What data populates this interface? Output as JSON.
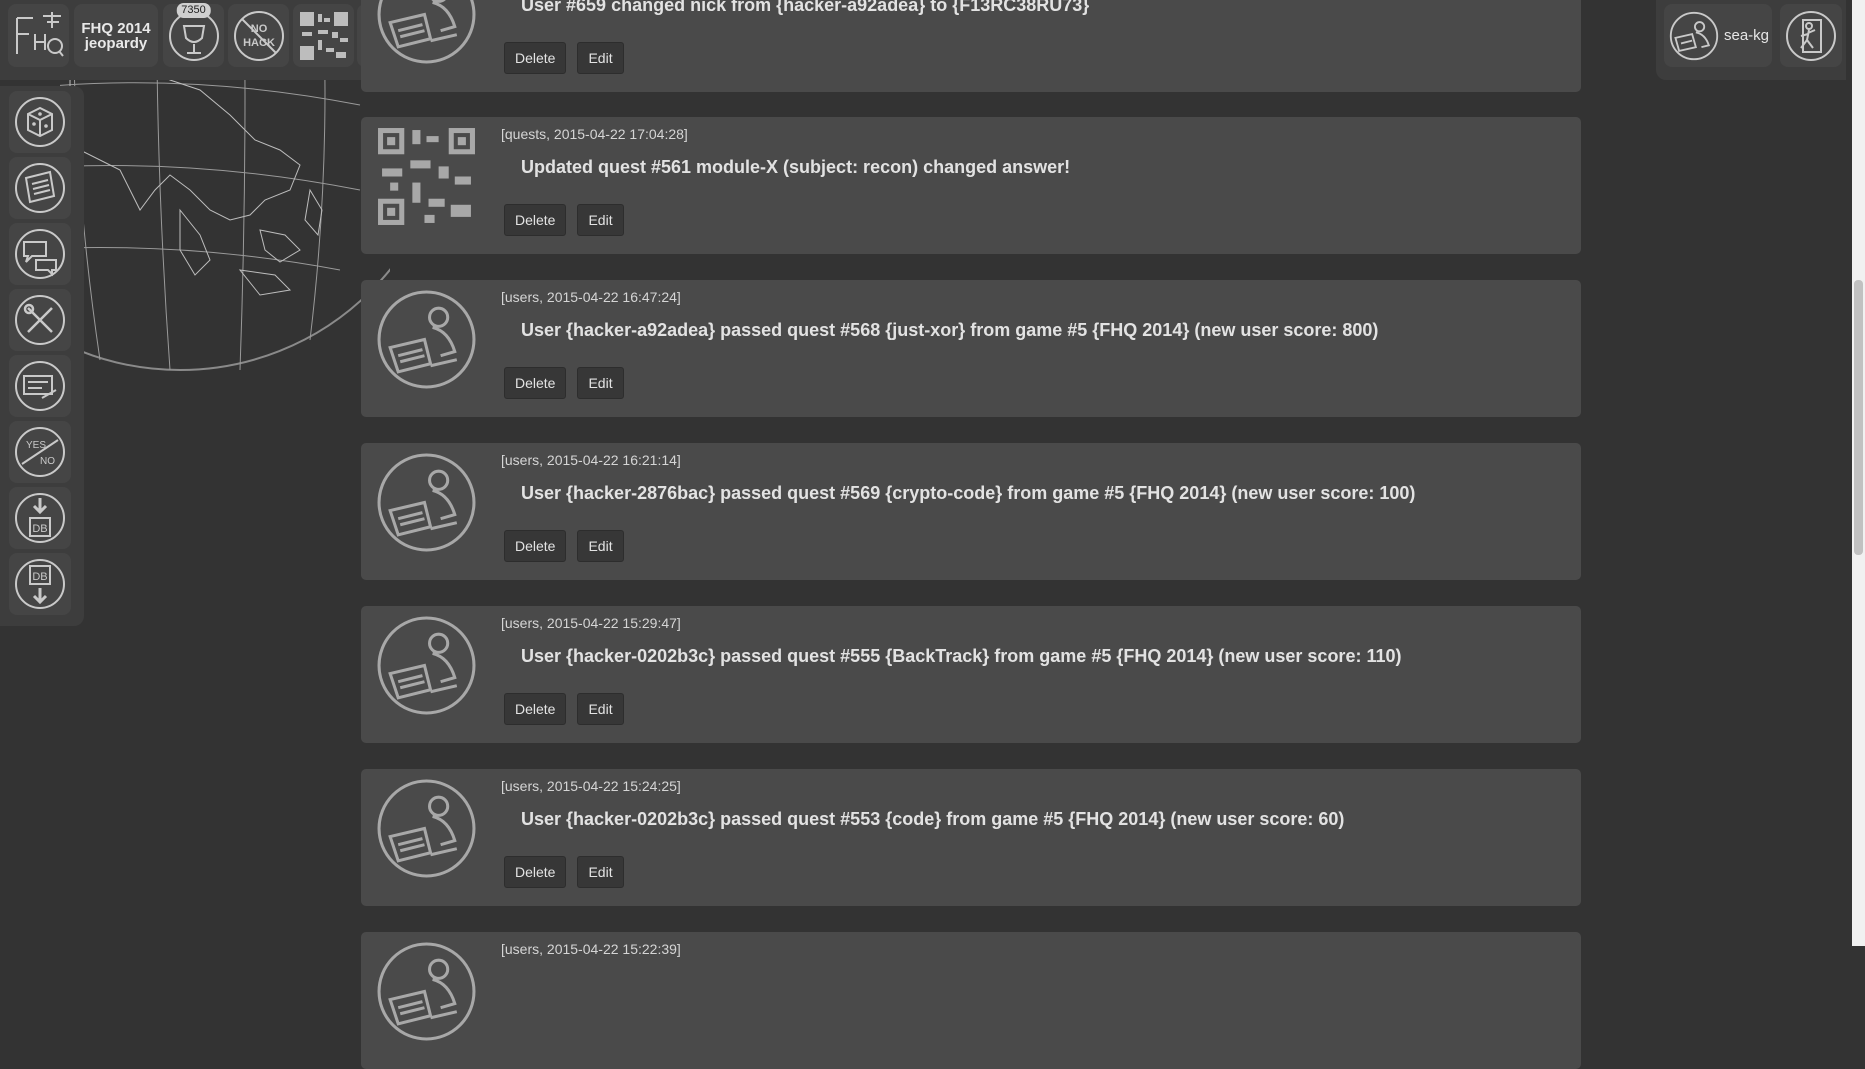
{
  "toolbar": {
    "logo_icon": "fhq-logo-icon",
    "game_title_line1": "FHQ 2014",
    "game_title_line2": "jeopardy",
    "score": "7350",
    "buttons": [
      "scoreboard-trophy-icon",
      "no-hack-icon",
      "qr-code-icon",
      "stats-pie-icon"
    ]
  },
  "sidebar": {
    "items": [
      "dice-icon",
      "news-icon",
      "chat-icon",
      "tools-icon",
      "feedback-icon",
      "yes-no-icon",
      "db-import-icon",
      "db-export-icon"
    ]
  },
  "user": {
    "name": "sea-kg",
    "avatar": "user-avatar-icon",
    "logout": "logout-icon"
  },
  "feed": {
    "items": [
      {
        "meta": "",
        "message": "User #659 changed nick from {hacker-a92adea} to {F13RC38RU73}",
        "avatar": "user-avatar-icon"
      },
      {
        "meta": "[quests, 2015-04-22 17:04:28]",
        "message": "Updated quest #561 module-X (subject: recon) changed answer!",
        "avatar": "qr-code-icon"
      },
      {
        "meta": "[users, 2015-04-22 16:47:24]",
        "message": "User {hacker-a92adea} passed quest #568 {just-xor} from game #5 {FHQ 2014} (new user score: 800)",
        "avatar": "user-avatar-icon"
      },
      {
        "meta": "[users, 2015-04-22 16:21:14]",
        "message": "User {hacker-2876bac} passed quest #569 {crypto-code} from game #5 {FHQ 2014} (new user score: 100)",
        "avatar": "user-avatar-icon"
      },
      {
        "meta": "[users, 2015-04-22 15:29:47]",
        "message": "User {hacker-0202b3c} passed quest #555 {BackTrack} from game #5 {FHQ 2014} (new user score: 110)",
        "avatar": "user-avatar-icon"
      },
      {
        "meta": "[users, 2015-04-22 15:24:25]",
        "message": "User {hacker-0202b3c} passed quest #553 {code} from game #5 {FHQ 2014} (new user score: 60)",
        "avatar": "user-avatar-icon"
      },
      {
        "meta": "[users, 2015-04-22 15:22:39]",
        "message": "",
        "avatar": "user-avatar-icon"
      }
    ],
    "delete_label": "Delete",
    "edit_label": "Edit"
  }
}
